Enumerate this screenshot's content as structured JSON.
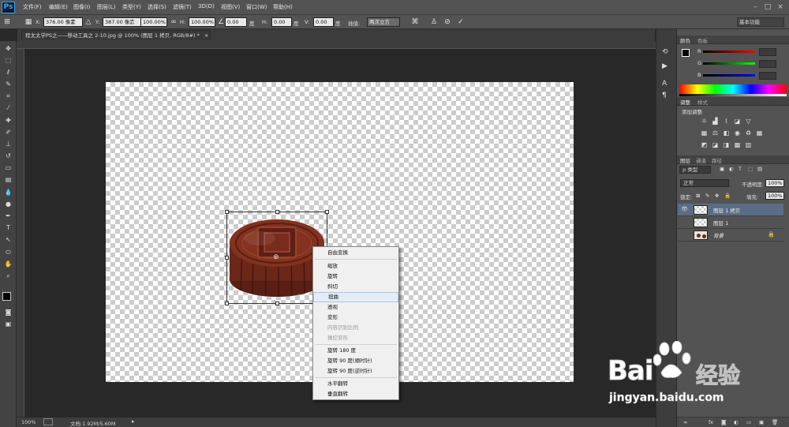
{
  "app": {
    "logo": "Ps"
  },
  "menubar": {
    "items": [
      "文件(F)",
      "编辑(E)",
      "图像(I)",
      "图层(L)",
      "类型(Y)",
      "选择(S)",
      "滤镜(T)",
      "3D(D)",
      "视图(V)",
      "窗口(W)",
      "帮助(H)"
    ],
    "window_controls": [
      "minimize-icon",
      "maximize-icon",
      "close-icon"
    ]
  },
  "options_bar": {
    "x_label": "X:",
    "x_value": "376.00 像素",
    "y_label": "Y:",
    "y_value": "387.00 像素",
    "w_label": "W:",
    "w_value": "100.00%",
    "h_label": "H:",
    "h_value": "100.00%",
    "angle_value": "0.00",
    "angle_unit": "度",
    "hskew_label": "H:",
    "hskew_value": "0.00",
    "hskew_unit": "度",
    "vskew_label": "V:",
    "vskew_value": "0.00",
    "vskew_unit": "度",
    "interp_label": "插值:",
    "interp_value": "两次立方",
    "workspace": "基本功能"
  },
  "document": {
    "tab_title": "程太太学PS之——移动工具之 2-10.jpg @ 100% (图层 1 拷贝, RGB/8#) *",
    "close": "×"
  },
  "context_menu": {
    "items": [
      {
        "label": "自由变换",
        "disabled": false,
        "highlight": false
      },
      {
        "label": "缩放",
        "disabled": false,
        "highlight": false
      },
      {
        "label": "旋转",
        "disabled": false,
        "highlight": false
      },
      {
        "label": "斜切",
        "disabled": false,
        "highlight": false
      },
      {
        "label": "扭曲",
        "disabled": false,
        "highlight": true
      },
      {
        "label": "透视",
        "disabled": false,
        "highlight": false
      },
      {
        "label": "变形",
        "disabled": false,
        "highlight": false
      },
      {
        "label": "内容识别比例",
        "disabled": true,
        "highlight": false
      },
      {
        "label": "操控变形",
        "disabled": true,
        "highlight": false
      },
      {
        "label": "旋转 180 度",
        "disabled": false,
        "highlight": false
      },
      {
        "label": "旋转 90 度(顺时针)",
        "disabled": false,
        "highlight": false
      },
      {
        "label": "旋转 90 度(逆时针)",
        "disabled": false,
        "highlight": false
      },
      {
        "label": "水平翻转",
        "disabled": false,
        "highlight": false
      },
      {
        "label": "垂直翻转",
        "disabled": false,
        "highlight": false
      }
    ]
  },
  "statusbar": {
    "zoom": "100%",
    "doc_info": "文档:1.92M/5.60M"
  },
  "color_panel": {
    "tab_active": "颜色",
    "tab_other": "色板",
    "r_label": "R",
    "g_label": "G",
    "b_label": "B"
  },
  "adjust_panel": {
    "tab_active": "调整",
    "tab_other": "样式",
    "title": "添加调整"
  },
  "layers_panel": {
    "tabs": [
      "图层",
      "通道",
      "路径"
    ],
    "filter": "ρ 类型",
    "blend_mode": "正常",
    "opacity_label": "不透明度:",
    "opacity_value": "100%",
    "lock_label": "锁定:",
    "fill_label": "填充:",
    "fill_value": "100%",
    "layers": [
      {
        "name": "图层 1 拷贝",
        "visible": true,
        "selected": true
      },
      {
        "name": "图层 1",
        "visible": false,
        "selected": false
      },
      {
        "name": "背景",
        "visible": false,
        "selected": false,
        "italic": true,
        "locked": true
      }
    ]
  },
  "watermark": {
    "brand": "Bai",
    "brand2": "经验",
    "url": "jingyan.baidu.com"
  },
  "colors": {
    "accent_selected_layer": "#5b6d85",
    "brand_red": "#d02a1e",
    "ps_blue": "#40aaf0"
  }
}
